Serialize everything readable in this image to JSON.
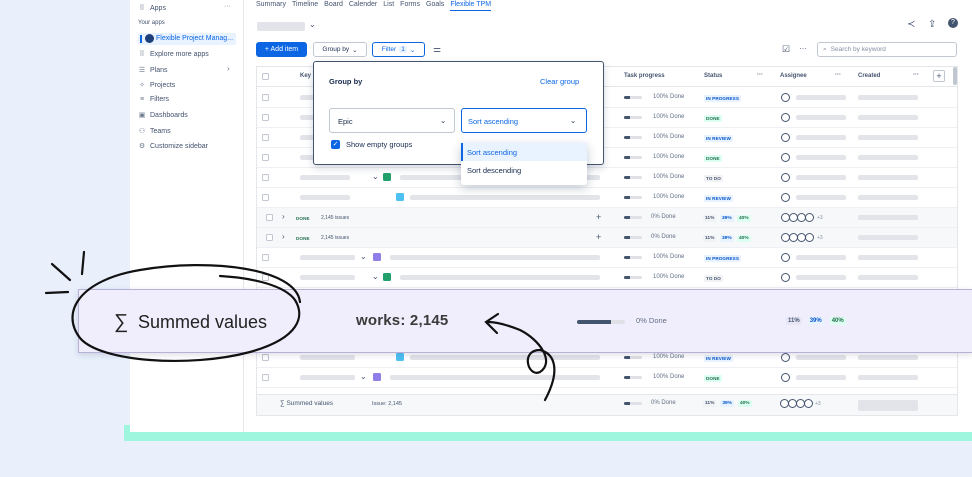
{
  "sidebar": {
    "apps": "Apps",
    "your_apps": "Your apps",
    "flexible_app": "Flexible Project Manag...",
    "explore": "Explore more apps",
    "plans": "Plans",
    "projects": "Projects",
    "filters": "Filters",
    "dashboards": "Dashboards",
    "teams": "Teams",
    "customize": "Customize sidebar",
    "more": "···",
    "chevron": "›"
  },
  "tabs": [
    "Summary",
    "Timeline",
    "Board",
    "Calender",
    "List",
    "Forms",
    "Goals",
    "Flexible TPM"
  ],
  "toolbar": {
    "add_item": "+ Add item",
    "group_by": "Group by",
    "filter": "Filter",
    "filter_count": "1",
    "search_placeholder": "Search by keyword",
    "more": "···"
  },
  "columns": {
    "key": "Key",
    "task_progress": "Task progress",
    "status": "Status",
    "assignee": "Assignee",
    "created": "Created",
    "more": "···",
    "add": "+"
  },
  "rows": [
    {
      "progress_text": "100% Done",
      "status": "IN PROGRESS",
      "status_color": "blue"
    },
    {
      "progress_text": "100% Done",
      "status": "DONE",
      "status_color": "green"
    },
    {
      "progress_text": "100% Done",
      "status": "IN REVIEW",
      "status_color": "blue"
    },
    {
      "progress_text": "100% Done",
      "status": "DONE",
      "status_color": "green"
    },
    {
      "progress_text": "100% Done",
      "status": "TO DO",
      "status_color": "gray"
    },
    {
      "progress_text": "100% Done",
      "status": "IN REVIEW",
      "status_color": "blue"
    }
  ],
  "groups": [
    {
      "status": "DONE",
      "count": "2,145 issues",
      "progress_text": "0% Done",
      "pcts": [
        "11%",
        "39%",
        "40%"
      ],
      "extra": "+3",
      "plus": "+"
    },
    {
      "status": "DONE",
      "count": "2,145 issues",
      "progress_text": "0% Done",
      "pcts": [
        "11%",
        "39%",
        "40%"
      ],
      "extra": "+3",
      "plus": "+"
    }
  ],
  "rows_after": [
    {
      "progress_text": "100% Done",
      "status": "IN PROGRESS"
    },
    {
      "progress_text": "100% Done",
      "status": "TO DO"
    }
  ],
  "rows_bottom": [
    {
      "progress_text": "100% Done",
      "status": "IN REVIEW"
    },
    {
      "progress_text": "100% Done",
      "status": "DONE"
    }
  ],
  "footer": {
    "label": "Summed values",
    "issue": "Issue: 2,145",
    "progress_text": "0% Done",
    "pcts": [
      "11%",
      "39%",
      "40%"
    ],
    "extra": "+3"
  },
  "popover": {
    "title": "Group by",
    "clear": "Clear group",
    "field_value": "Epic",
    "sort_value": "Sort ascending",
    "show_empty": "Show empty groups"
  },
  "dropdown": {
    "options": [
      "Sort ascending",
      "Sort descending"
    ]
  },
  "highlight": {
    "label": "Summed values",
    "works": "works: 2,145",
    "progress_text": "0% Done",
    "pcts": [
      "11%",
      "39%",
      "40%"
    ]
  },
  "colors": {
    "accent": "#0c66e4",
    "green": "#216e4e",
    "blue": "#0055cc",
    "teal": "#9ff6de",
    "highlight": "#f0eefc"
  }
}
